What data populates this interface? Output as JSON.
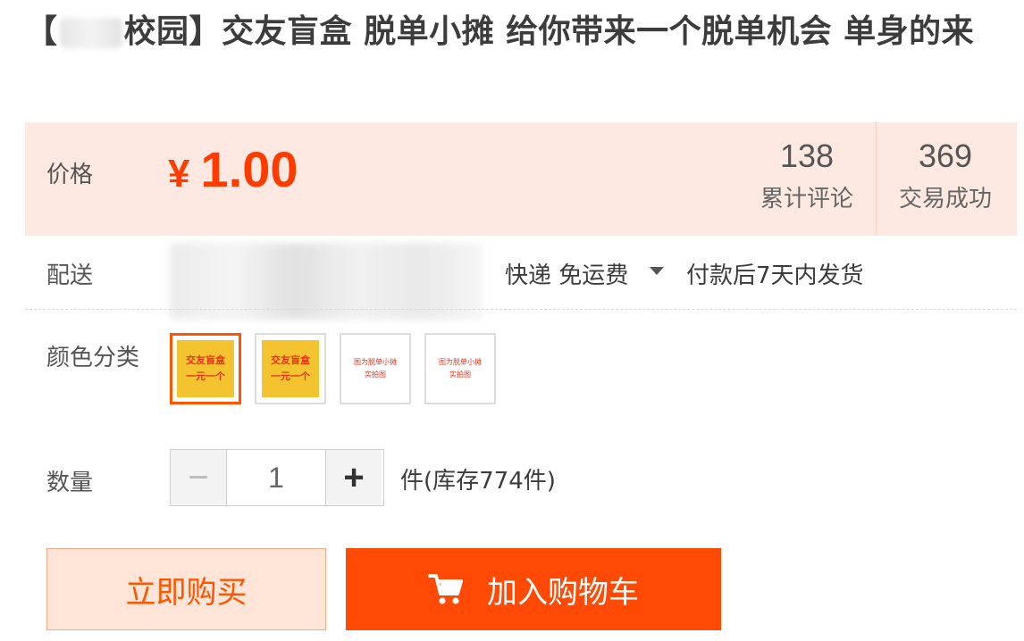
{
  "title": {
    "bracket_open": "【",
    "campus": "校园】",
    "text": "交友盲盒 脱单小摊 给你带来一个脱单机会 单身的来"
  },
  "price": {
    "label": "价格",
    "currency": "¥",
    "amount": "1.00"
  },
  "stats": [
    {
      "value": "138",
      "label": "累计评论"
    },
    {
      "value": "369",
      "label": "交易成功"
    }
  ],
  "shipping": {
    "label": "配送",
    "method": "快递 免运费",
    "delivery": "付款后7天内发货"
  },
  "color": {
    "label": "颜色分类",
    "options": [
      {
        "line1": "交友盲盒",
        "line2": "一元一个"
      },
      {
        "line1": "交友盲盒",
        "line2": "一元一个"
      },
      {
        "line1": "图为脱单小摊",
        "line2": "实拍图"
      },
      {
        "line1": "图为脱单小摊",
        "line2": "实拍图"
      }
    ]
  },
  "quantity": {
    "label": "数量",
    "minus": "−",
    "value": "1",
    "plus": "+",
    "stock_text": "件(库存774件)"
  },
  "actions": {
    "buy_now": "立即购买",
    "add_to_cart": "加入购物车"
  },
  "colors": {
    "accent": "#ff4a05",
    "price": "#ff3c00",
    "price_panel_bg": "#fde9e2"
  }
}
